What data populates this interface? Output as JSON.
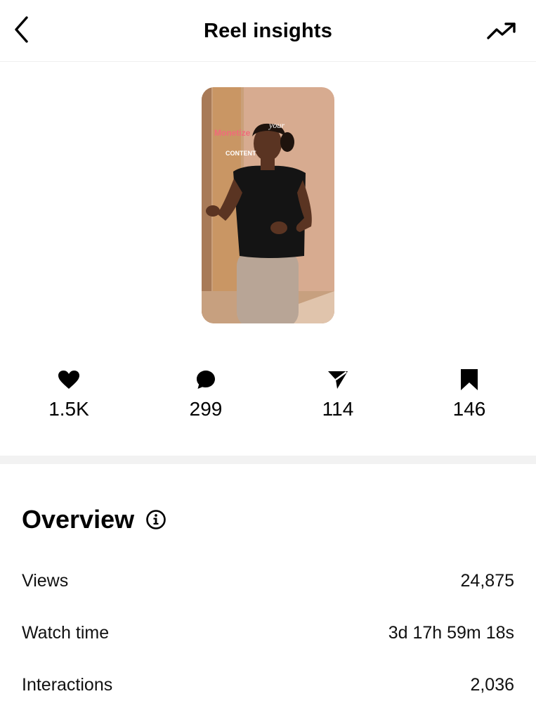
{
  "header": {
    "title": "Reel insights",
    "back_icon": "chevron-left-icon",
    "trend_icon": "trending-up-icon"
  },
  "reel": {
    "overlay_word_1": "Monetize",
    "overlay_word_2": "your",
    "overlay_word_3": "CONTENT"
  },
  "stats": [
    {
      "icon": "heart-icon",
      "value": "1.5K"
    },
    {
      "icon": "comment-icon",
      "value": "299"
    },
    {
      "icon": "share-icon",
      "value": "114"
    },
    {
      "icon": "bookmark-icon",
      "value": "146"
    }
  ],
  "overview": {
    "title": "Overview",
    "info_icon": "info-icon",
    "rows": [
      {
        "label": "Views",
        "value": "24,875"
      },
      {
        "label": "Watch time",
        "value": "3d 17h 59m 18s"
      },
      {
        "label": "Interactions",
        "value": "2,036"
      }
    ]
  },
  "colors": {
    "overlay_pink": "#f06b7a",
    "wall": "#d8a98c"
  }
}
